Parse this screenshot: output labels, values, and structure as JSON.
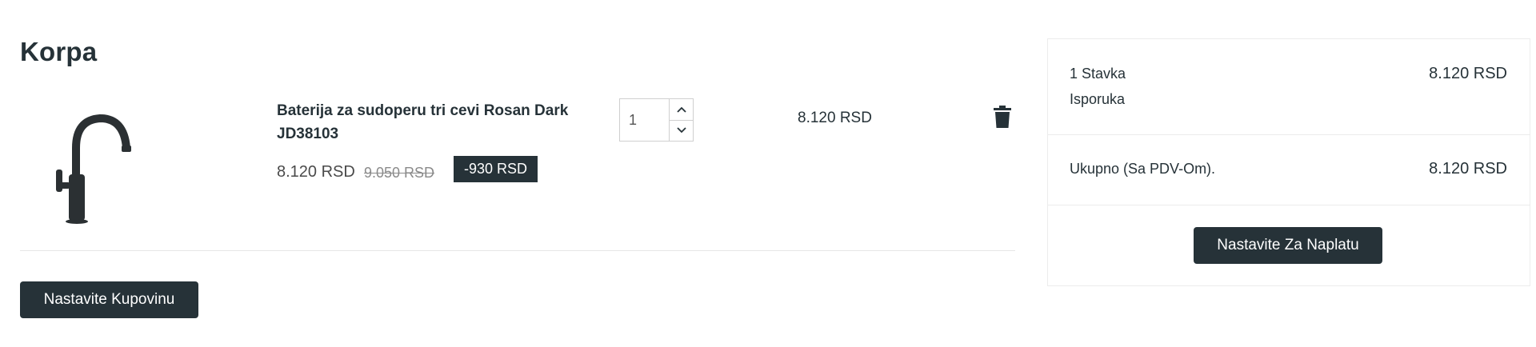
{
  "page": {
    "title": "Korpa"
  },
  "cart_item": {
    "image_alt": "faucet-image",
    "name": "Baterija za sudoperu tri cevi Rosan Dark JD38103",
    "price_current": "8.120 RSD",
    "price_old": "9.050 RSD",
    "discount": "-930 RSD",
    "quantity": "1",
    "line_total": "8.120 RSD"
  },
  "actions": {
    "continue_shopping": "Nastavite Kupovinu",
    "checkout": "Nastavite Za Naplatu"
  },
  "summary": {
    "items_label": "1 Stavka",
    "items_value": "8.120 RSD",
    "shipping_label": "Isporuka",
    "total_label": "Ukupno (Sa PDV-Om).",
    "total_value": "8.120 RSD"
  },
  "icons": {
    "delete": "trash-icon",
    "qty_up": "chevron-up-icon",
    "qty_down": "chevron-down-icon"
  },
  "colors": {
    "dark": "#263238",
    "border": "#ececec"
  }
}
